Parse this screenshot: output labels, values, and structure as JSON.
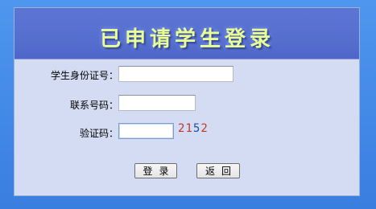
{
  "header": {
    "title": "已申请学生登录"
  },
  "form": {
    "student_id": {
      "label": "学生身份证号：",
      "value": ""
    },
    "phone": {
      "label": "联系号码：",
      "value": ""
    },
    "captcha": {
      "label": "验证码：",
      "value": "",
      "code_digits": [
        {
          "char": "2",
          "color": "#c0392b"
        },
        {
          "char": "1",
          "color": "#c0392b"
        },
        {
          "char": "5",
          "color": "#1f4fa8"
        },
        {
          "char": "2",
          "color": "#c0392b"
        }
      ]
    }
  },
  "buttons": {
    "login_label": "登录",
    "back_label": "返回"
  },
  "colors": {
    "background": "#3f86e6",
    "panel": "#d3dcf2",
    "header": "#5670cf",
    "title_text": "#e9ff96"
  }
}
